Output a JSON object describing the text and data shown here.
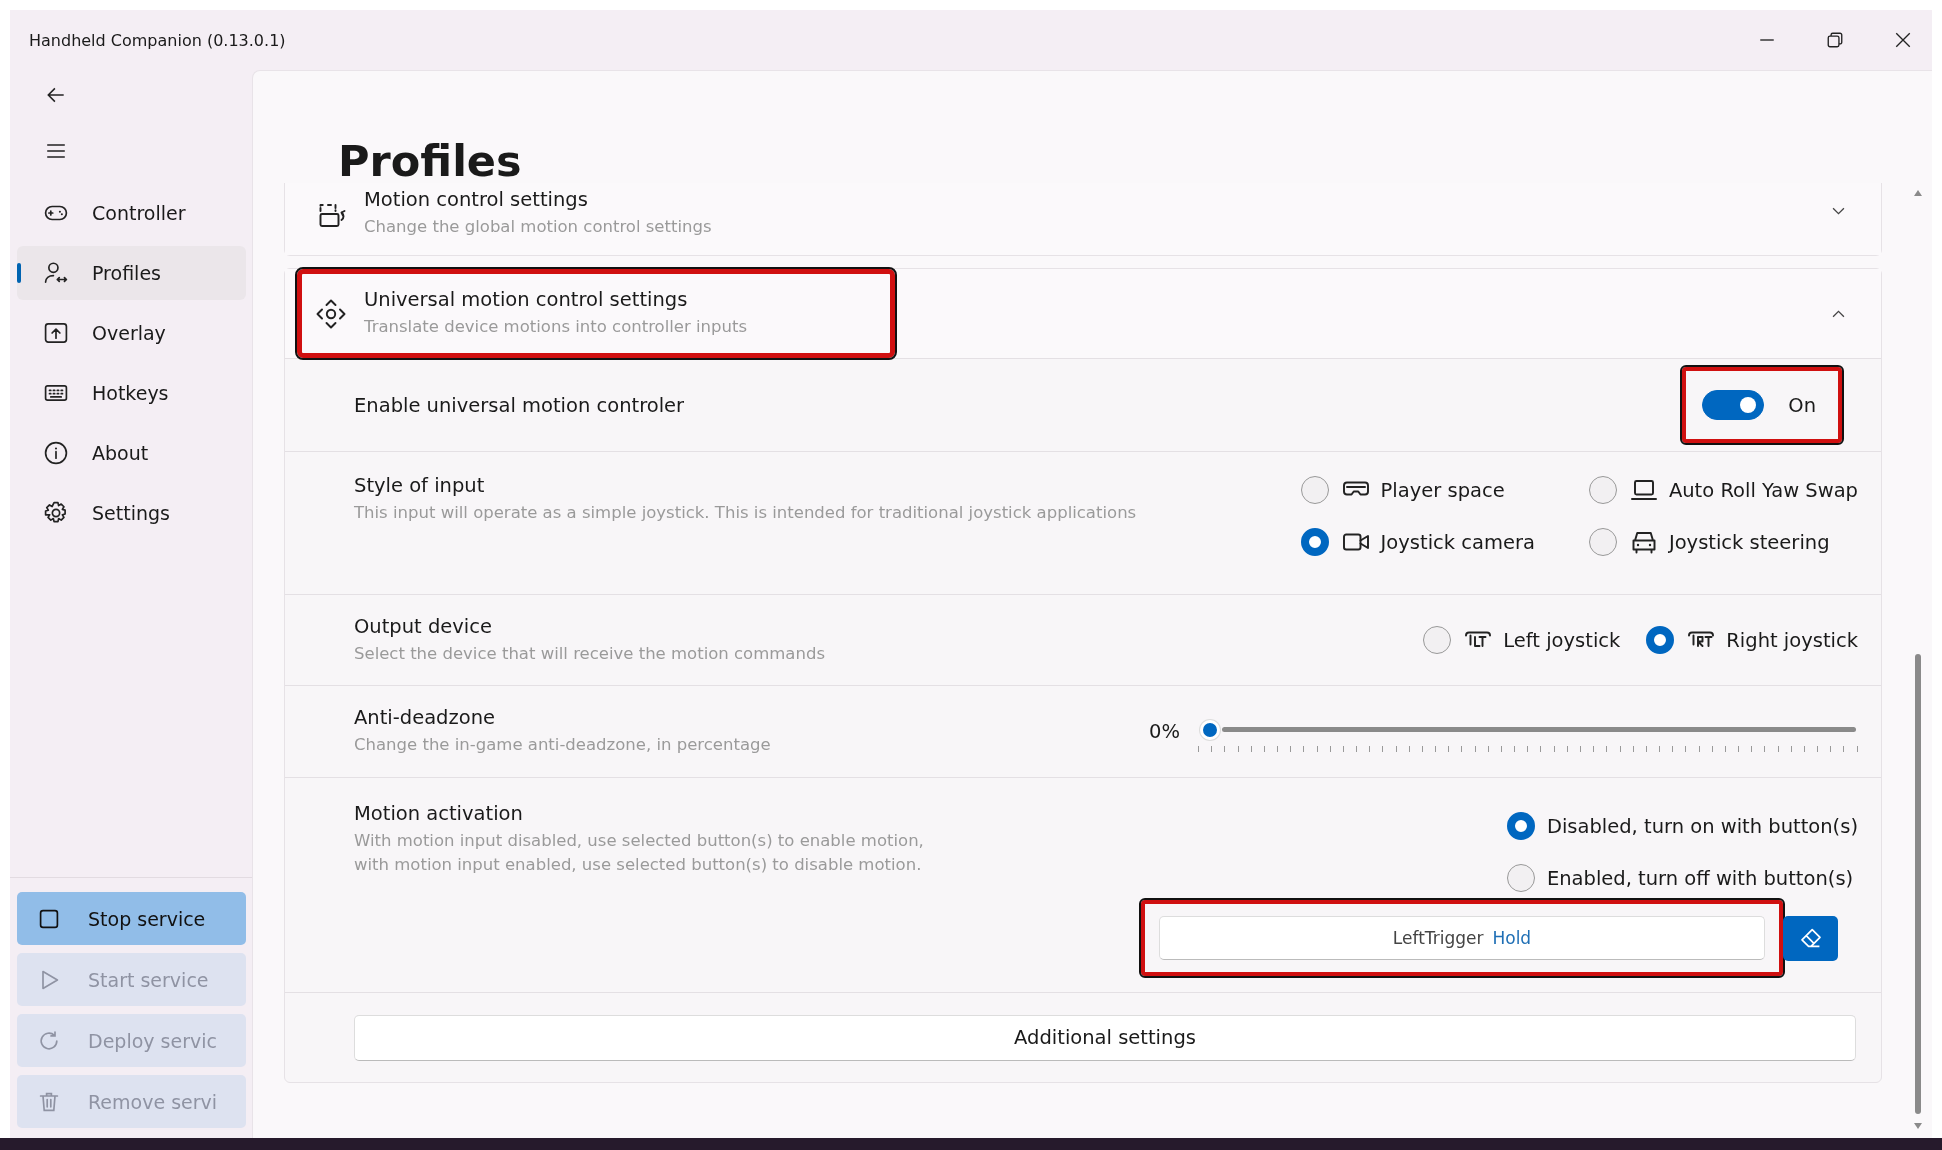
{
  "window": {
    "title": "Handheld Companion (0.13.0.1)"
  },
  "sidebar": {
    "items": [
      {
        "label": "Controller",
        "selected": false
      },
      {
        "label": "Profiles",
        "selected": true
      },
      {
        "label": "Overlay",
        "selected": false
      },
      {
        "label": "Hotkeys",
        "selected": false
      },
      {
        "label": "About",
        "selected": false
      },
      {
        "label": "Settings",
        "selected": false
      }
    ],
    "service_buttons": [
      {
        "label": "Stop service",
        "disabled": false
      },
      {
        "label": "Start service",
        "disabled": true
      },
      {
        "label": "Deploy servic",
        "disabled": true
      },
      {
        "label": "Remove servi",
        "disabled": true
      }
    ]
  },
  "page": {
    "title": "Profiles",
    "sections": [
      {
        "title": "Motion control settings",
        "description": "Change the global motion control settings",
        "expanded": false,
        "highlighted": false
      },
      {
        "title": "Universal motion control settings",
        "description": "Translate device motions into controller inputs",
        "expanded": true,
        "highlighted": true,
        "rows": [
          {
            "kind": "toggle",
            "label": "Enable universal motion controler",
            "on": true,
            "state_text": "On",
            "highlighted": true
          },
          {
            "kind": "radio_grid",
            "label": "Style of input",
            "description": "This input will operate as a simple joystick. This is intended for traditional joystick applications",
            "options": [
              {
                "label": "Player space",
                "selected": false
              },
              {
                "label": "Auto Roll Yaw Swap",
                "selected": false
              },
              {
                "label": "Joystick camera",
                "selected": true
              },
              {
                "label": "Joystick steering",
                "selected": false
              }
            ]
          },
          {
            "kind": "radio_row",
            "label": "Output device",
            "description": "Select the device that will receive the motion commands",
            "options": [
              {
                "label": "Left joystick",
                "selected": false
              },
              {
                "label": "Right joystick",
                "selected": true
              }
            ]
          },
          {
            "kind": "slider",
            "label": "Anti-deadzone",
            "description": "Change the in-game anti-deadzone, in percentage",
            "reading": "0%",
            "level": 0
          },
          {
            "kind": "activation",
            "label": "Motion activation",
            "description": "With motion input disabled, use selected button(s) to enable motion,\nwith motion input enabled, use selected button(s) to disable motion.",
            "options": [
              {
                "label": "Disabled, turn on with button(s)",
                "selected": true
              },
              {
                "label": "Enabled, turn off with button(s)",
                "selected": false
              }
            ],
            "hotkey": {
              "button": "LeftTrigger",
              "mode": "Hold",
              "highlighted": true
            }
          },
          {
            "kind": "button",
            "label": "Additional settings"
          }
        ]
      }
    ]
  }
}
